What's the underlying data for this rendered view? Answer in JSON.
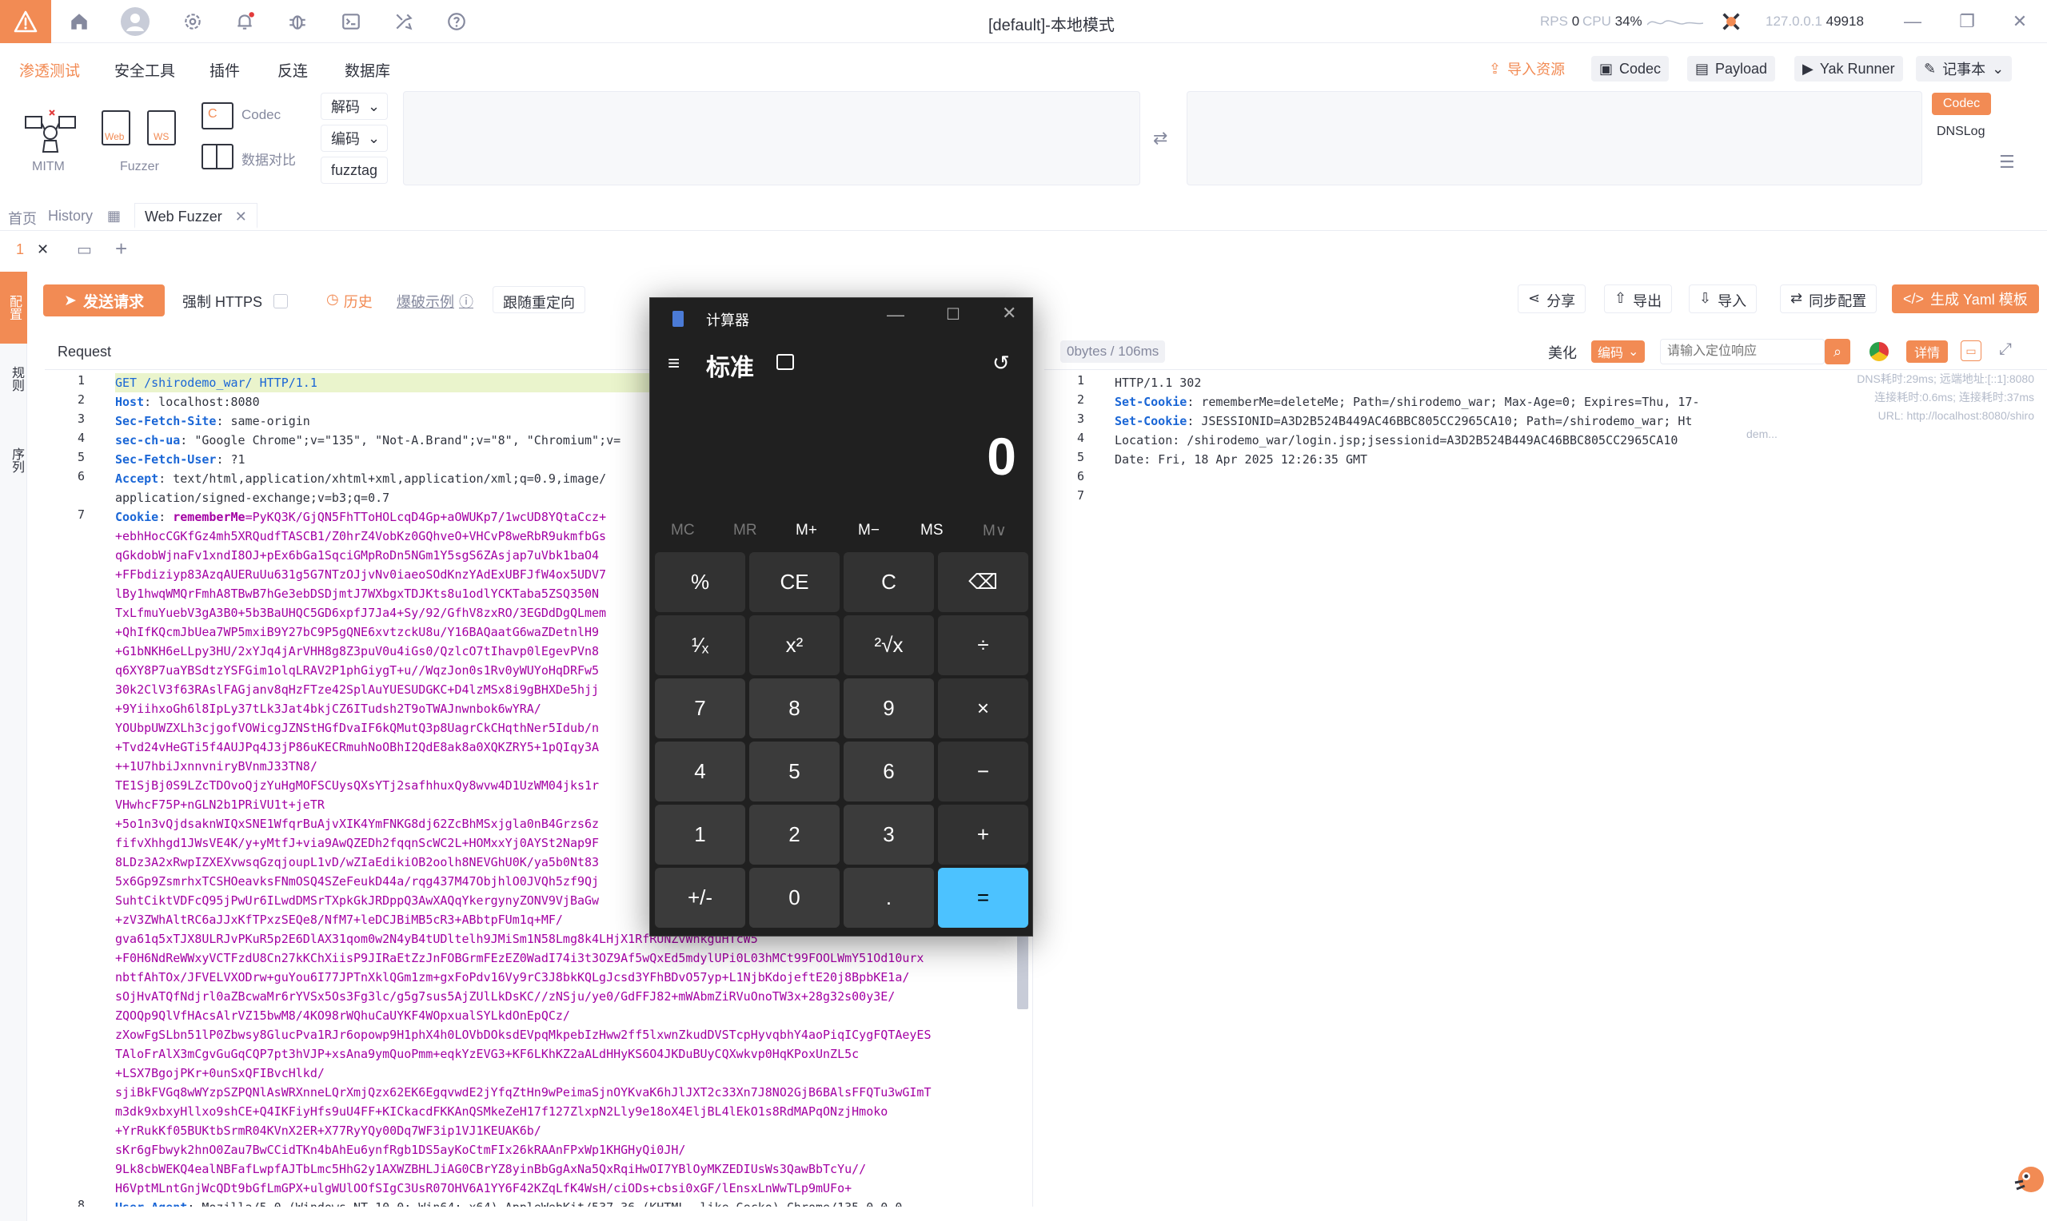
{
  "app": {
    "window_title": "[default]-本地模式",
    "rps_label": "RPS",
    "rps_value": "0",
    "cpu_label": "CPU",
    "cpu_value": "34%",
    "address": "127.0.0.1",
    "port": "49918"
  },
  "menu": {
    "items": [
      "渗透测试",
      "安全工具",
      "插件",
      "反连",
      "数据库"
    ],
    "active_index": 0,
    "right_buttons": {
      "import_resource": "导入资源",
      "codec": "Codec",
      "payload": "Payload",
      "yak_runner": "Yak Runner",
      "notepad": "记事本"
    }
  },
  "tools": {
    "mitm": "MITM",
    "fuzzer": "Fuzzer",
    "web_badge": "Web",
    "ws_badge": "WS",
    "codec": "Codec",
    "data_compare": "数据对比",
    "decode": "解码",
    "encode": "编码",
    "fuzztag": "fuzztag",
    "side_codec": "Codec",
    "side_dnslog": "DNSLog"
  },
  "tabs": {
    "home": "首页",
    "history": "History",
    "web_fuzzer": "Web Fuzzer",
    "sub_tab_index": "1"
  },
  "side_rail": {
    "item1": "配置",
    "item2": "规则",
    "item3": "序列"
  },
  "fuzzer_toolbar": {
    "send": "发送请求",
    "force_https": "强制 HTTPS",
    "history": "历史",
    "blast_example": "爆破示例",
    "follow_redirect": "跟随重定向",
    "share": "分享",
    "export": "导出",
    "import": "导入",
    "sync_config": "同步配置",
    "gen_yaml": "生成 Yaml 模板"
  },
  "request": {
    "title": "Request",
    "lines": [
      {
        "n": "1",
        "text": "GET /shirodemo_war/ HTTP/1.1"
      },
      {
        "n": "2",
        "key": "Host",
        "value": ": localhost:8080"
      },
      {
        "n": "3",
        "key": "Sec-Fetch-Site",
        "value": ": same-origin"
      },
      {
        "n": "4",
        "key": "sec-ch-ua",
        "value": ": \"Google Chrome\";v=\"135\", \"Not-A.Brand\";v=\"8\", \"Chromium\";v="
      },
      {
        "n": "5",
        "key": "Sec-Fetch-User",
        "value": ": ?1"
      },
      {
        "n": "6",
        "key": "Accept",
        "value": ": text/html,application/xhtml+xml,application/xml;q=0.9,image/"
      },
      {
        "n": "",
        "value": "application/signed-exchange;v=b3;q=0.7"
      },
      {
        "n": "7",
        "key": "Cookie",
        "value": ": ",
        "cookie_key": "rememberMe",
        "cookie_value": "=PyKQ3K/GjQN5FhTToHOLcqD4Gp+aOWUKp7/1wcUD8YQtaCcz+"
      },
      {
        "n": "",
        "cookie_value": "+ebhHocCGKfGz4mh5XRQudfTASCB1/Z0hrZ4VobKz0GQhveO+VHCvP8weRbR9ukmfbGs"
      },
      {
        "n": "",
        "cookie_value": "qGkdobWjnaFv1xndI8OJ+pEx6bGa1SqciGMpRoDn5NGm1Y5sgS6ZAsjap7uVbk1baO4"
      },
      {
        "n": "",
        "cookie_value": "+FFbdiziyp83AzqAUERuUu631g5G7NTzOJjvNv0iaeoSOdKnzYAdExUBFJfW4ox5UDV7"
      },
      {
        "n": "",
        "cookie_value": "lBy1hwqWMQrFmhA8TBwB7hGe3ebDSDjmtJ7WXbgxTDJKts8u1odlYCKTaba5ZSQ350N"
      },
      {
        "n": "",
        "cookie_value": "TxLfmuYuebV3gA3B0+5b3BaUHQC5GD6xpfJ7Ja4+Sy/92/GfhV8zxRO/3EGDdDgQLmem"
      },
      {
        "n": "",
        "cookie_value": "+QhIfKQcmJbUea7WP5mxiB9Y27bC9P5gQNE6xvtzckU8u/Y16BAQaatG6waZDetnlH9"
      },
      {
        "n": "",
        "cookie_value": "+G1bNKH6eLLpy3HU/2xYJq4jArVHH8g8Z3puV0u4iGs0/QzlcO7tIhavp0lEgevPVn8"
      },
      {
        "n": "",
        "cookie_value": "q6XY8P7uaYBSdtzYSFGim1olqLRAV2P1phGiygT+u//WqzJon0s1Rv0yWUYoHqDRFw5"
      },
      {
        "n": "",
        "cookie_value": "30k2ClV3f63RAslFAGjanv8qHzFTze42SplAuYUESUDGKC+D4lzMSx8i9gBHXDe5hjj"
      },
      {
        "n": "",
        "cookie_value": "+9YiihxoGh6l8IpLy37tLk3Jat4bkjCZ6ITudsh2T9oTWAJnwnbok6wYRA/"
      },
      {
        "n": "",
        "cookie_value": "YOUbpUWZXLh3cjgofVOWicgJZNStHGfDvaIF6kQMutQ3p8UagrCkCHqthNer5Idub/n"
      },
      {
        "n": "",
        "cookie_value": "+Tvd24vHeGTi5f4AUJPq4J3jP86uKECRmuhNoOBhI2QdE8ak8a0XQKZRY5+1pQIqy3A"
      },
      {
        "n": "",
        "cookie_value": "++1U7hbiJxnnvniryBVnmJ33TN8/"
      },
      {
        "n": "",
        "cookie_value": "TE1SjBj0S9LZcTDOvoQjzYuHgMOFSCUysQXsYTj2safhhuxQy8wvw4D1UzWM04jks1r"
      },
      {
        "n": "",
        "cookie_value": "VHwhcF75P+nGLN2b1PRiVU1t+jeTR"
      },
      {
        "n": "",
        "cookie_value": "+5o1n3vQjdsaknWIQxSNE1WfqrBuAjvXIK4YmFNKG8dj62ZcBhMSxjgla0nB4Grzs6z"
      },
      {
        "n": "",
        "cookie_value": "fifvXhhgd1JWsVE4K/y+yMtfJ+via9AwQZEDh2fqqnScWC2L+HOMxxYj0AYSt2Nap9F"
      },
      {
        "n": "",
        "cookie_value": "8LDz3A2xRwpIZXEXvwsqGzqjoupL1vD/wZIaEdikiOB2oolh8NEVGhU0K/ya5b0Nt83"
      },
      {
        "n": "",
        "cookie_value": "5x6Gp9ZsmrhxTCSHOeavksFNmOSQ4SZeFeukD44a/rqg437M47ObjhlO0JVQh5zf9Qj"
      },
      {
        "n": "",
        "cookie_value": "SuhtCiktVDFcQ95jPwUr6ILwdDMSrTXpkGkJRDppQ3AwXAQqYkergynyZONV9VjBaGw"
      },
      {
        "n": "",
        "cookie_value": "+zV3ZWhAltRC6aJJxKfTPxzSEQe8/NfM7+leDCJBiMB5cR3+ABbtpFUm1q+MF/"
      },
      {
        "n": "",
        "cookie_value": "gva61q5xTJX8ULRJvPKuR5p2E6DlAX31qom0w2N4yB4tUDltelh9JMiSm1N58Lmg8k4LHjX1RfRUNZvWhkguHTcW5"
      },
      {
        "n": "",
        "cookie_value": "+F0H6NdReWWxyVCTFzdU8Cn27kKChXiisP9JIRaEtZzJnFOBGrmFEzEZ0WadI74i3t3OZ9Af5wQxEd5mdylUPi0L03hMCt99FOOLWmY51Od10urx"
      },
      {
        "n": "",
        "cookie_value": "nbtfAhTOx/JFVELVXODrw+guYou6I77JPTnXklQGm1zm+gxFoPdv16Vy9rC3J8bkKQLgJcsd3YFhBDvO57yp+L1NjbKdojeftE20j8BpbKE1a/"
      },
      {
        "n": "",
        "cookie_value": "sOjHvATQfNdjrl0aZBcwaMr6rYVSx5Os3Fg3lc/g5g7sus5AjZUlLkDsKC//zNSju/ye0/GdFFJ82+mWAbmZiRVuOnoTW3x+28g32s00y3E/"
      },
      {
        "n": "",
        "cookie_value": "ZQOQp9QlVfHAcsAlrVZ15bwM8/4KO98rWQhuCaUYKF4WOpxualSYLkdOnEpQCz/"
      },
      {
        "n": "",
        "cookie_value": "zXowFgSLbn51lP0Zbwsy8GlucPva1RJr6opowp9H1phX4h0LOVbDOksdEVpqMkpebIzHww2ff5lxwnZkudDVSTcpHyvqbhY4aoPiqICygFQTAeyES"
      },
      {
        "n": "",
        "cookie_value": "TAloFrAlX3mCgvGuGqCQP7pt3hVJP+xsAna9ymQuoPmm+eqkYzEVG3+KF6LKhKZ2aALdHHyKS6O4JKDuBUyCQXwkvp0HqKPoxUnZL5c"
      },
      {
        "n": "",
        "cookie_value": "+LSX7BgojPKr+0unSxQFIBvcHlkd/"
      },
      {
        "n": "",
        "cookie_value": "sjiBkFVGq8wWYzpSZPQNlAsWRXnneLQrXmjQzx62EK6EgqvwdE2jYfqZtHn9wPeimaSjnOYKvaK6hJlJXT2c33Xn7J8NO2GjB6BAlsFFQTu3wGImT"
      },
      {
        "n": "",
        "cookie_value": "m3dk9xbxyHllxo9shCE+Q4IKFiyHfs9uU4FF+KICkacdFKKAnQSMkeZeH17f127ZlxpN2Lly9e18oX4EljBL4lEkO1s8RdMAPqONzjHmoko"
      },
      {
        "n": "",
        "cookie_value": "+YrRukKf05BUKtbSrmR04KVnX2ER+X77RyYQy00Dq7WF3ip1VJ1KEUAK6b/"
      },
      {
        "n": "",
        "cookie_value": "sKr6gFbwyk2hnO0Zau7BwCCidTKn4bAhEu6ynfRgb1DS5ayKoCtmFIx26kRAAnFPxWp1KHGHyQi0JH/"
      },
      {
        "n": "",
        "cookie_value": "9Lk8cbWEKQ4ealNBFafLwpfAJTbLmc5HhG2y1AXWZBHLJiAG0CBrYZ8yinBbGgAxNa5QxRqiHwOI7YBlOyMKZEDIUsWs3QawBbTcYu//"
      },
      {
        "n": "",
        "cookie_value": "H6VptMLntGnjWcQDt9bGfLmGPX+ulgWUlOOfSIgC3UsR07OHV6A1YY6F42KZqLfK4WsH/ciODs+cbsi0xGF/lEnsxLnWwTLp9mUFo+"
      },
      {
        "n": "8",
        "key": "User-Agent",
        "value": ": Mozilla/5.0 (Windows NT 10.0; Win64; x64) AppleWebKit/537.36 (KHTML, like Gecko) Chrome/135.0.0.0"
      }
    ]
  },
  "response": {
    "meta": "0bytes / 106ms",
    "beautify": "美化",
    "encoding": "编码",
    "search_placeholder": "请输入定位响应",
    "details": "详情",
    "dns_info": "DNS耗时:29ms; 远端地址:[::1]:8080",
    "connect_info": "连接耗时:0.6ms; 连接耗时:37ms",
    "url_info": "URL: http://localhost:8080/shiro",
    "url_tail": "dem...",
    "lines": [
      {
        "n": "1",
        "text": "HTTP/1.1 302"
      },
      {
        "n": "2",
        "key": "Set-Cookie",
        "value": ": rememberMe=deleteMe; Path=/shirodemo_war; Max-Age=0; Expires=Thu, 17-"
      },
      {
        "n": "3",
        "key": "Set-Cookie",
        "value": ": JSESSIONID=A3D2B524B449AC46BBC805CC2965CA10; Path=/shirodemo_war; Ht"
      },
      {
        "n": "4",
        "text": "Location: /shirodemo_war/login.jsp;jsessionid=A3D2B524B449AC46BBC805CC2965CA10"
      },
      {
        "n": "5",
        "text": "Date: Fri, 18 Apr 2025 12:26:35 GMT"
      },
      {
        "n": "6",
        "text": ""
      },
      {
        "n": "7",
        "text": ""
      }
    ]
  },
  "calculator": {
    "title": "计算器",
    "mode": "标准",
    "display": "0",
    "memory": [
      "MC",
      "MR",
      "M+",
      "M−",
      "MS",
      "M∨"
    ],
    "keys": [
      [
        "%",
        "CE",
        "C",
        "⌫"
      ],
      [
        "¹⁄ₓ",
        "x²",
        "²√x",
        "÷"
      ],
      [
        "7",
        "8",
        "9",
        "×"
      ],
      [
        "4",
        "5",
        "6",
        "−"
      ],
      [
        "1",
        "2",
        "3",
        "+"
      ],
      [
        "+/-",
        "0",
        ".",
        "="
      ]
    ]
  },
  "colors": {
    "accent": "#f28b54",
    "link_blue": "#1a66d6",
    "cookie_purple": "#a300a3",
    "calc_equals": "#4cc2ff"
  }
}
